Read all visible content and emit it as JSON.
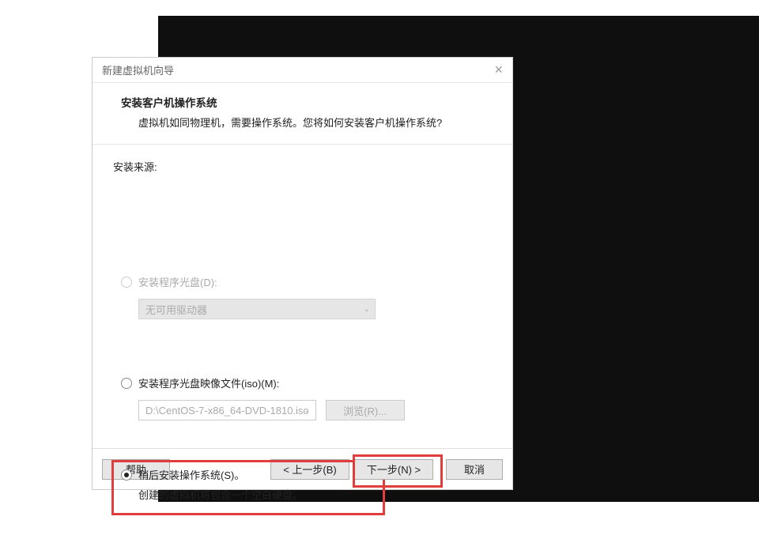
{
  "dialog": {
    "title": "新建虚拟机向导",
    "header_title": "安装客户机操作系统",
    "header_sub": "虚拟机如同物理机，需要操作系统。您将如何安装客户机操作系统?"
  },
  "source": {
    "label": "安装来源:",
    "disc": {
      "label": "安装程序光盘(D):",
      "combo": "无可用驱动器"
    },
    "iso": {
      "label": "安装程序光盘映像文件(iso)(M):",
      "path": "D:\\CentOS-7-x86_64-DVD-1810.iso",
      "browse": "浏览(R)..."
    },
    "later": {
      "label": "稍后安装操作系统(S)。",
      "sub": "创建的虚拟机将包含一个空白硬盘。"
    }
  },
  "buttons": {
    "help": "帮助",
    "back": "< 上一步(B)",
    "next": "下一步(N) >",
    "cancel": "取消"
  }
}
